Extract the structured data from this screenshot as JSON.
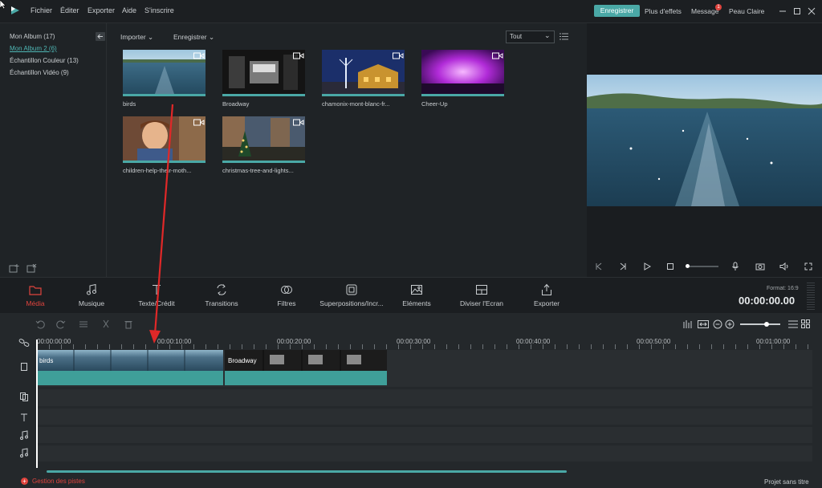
{
  "menu": [
    "Fichier",
    "Éditer",
    "Exporter",
    "Aide",
    "S'inscrire"
  ],
  "titlebar": {
    "register_button": "Enregistrer",
    "more_effects": "Plus d'effets",
    "message": "Message",
    "message_count": "1",
    "skin": "Peau Claire"
  },
  "sidebar": {
    "items": [
      {
        "label": "Mon Album (17)"
      },
      {
        "label": "Mon Album 2 (6)"
      },
      {
        "label": "Échantillon Couleur (13)"
      },
      {
        "label": "Échantillon Vidéo (9)"
      }
    ]
  },
  "media": {
    "import_label": "Importer",
    "record_label": "Enregistrer",
    "filter_value": "Tout",
    "items": [
      {
        "label": "birds"
      },
      {
        "label": "Broadway"
      },
      {
        "label": "chamonix-mont-blanc-fr..."
      },
      {
        "label": "Cheer-Up"
      },
      {
        "label": "children-help-their-moth..."
      },
      {
        "label": "christmas-tree-and-lights..."
      }
    ]
  },
  "toolbar": {
    "tools": [
      {
        "label": "Média"
      },
      {
        "label": "Musique"
      },
      {
        "label": "Texte/Crédit"
      },
      {
        "label": "Transitions"
      },
      {
        "label": "Filtres"
      },
      {
        "label": "Superpositions/Incr..."
      },
      {
        "label": "Eléments"
      },
      {
        "label": "Diviser l'Ecran"
      },
      {
        "label": "Exporter"
      }
    ],
    "format": "Format: 16:9",
    "timecode": "00:00:00.00"
  },
  "timeline": {
    "ruler": [
      "00:00:00:00",
      "00:00:10:00",
      "00:00:20:00",
      "00:00:30:00",
      "00:00:40:00",
      "00:00:50:00",
      "00:01:00:00"
    ],
    "clips": [
      {
        "label": "birds"
      },
      {
        "label": "Broadway"
      }
    ],
    "track_manager": "Gestion des pistes",
    "project_name": "Projet sans titre"
  },
  "colors": {
    "accent": "#4aa8a6",
    "active_tool": "#e0443e",
    "arrow": "#e02828"
  }
}
